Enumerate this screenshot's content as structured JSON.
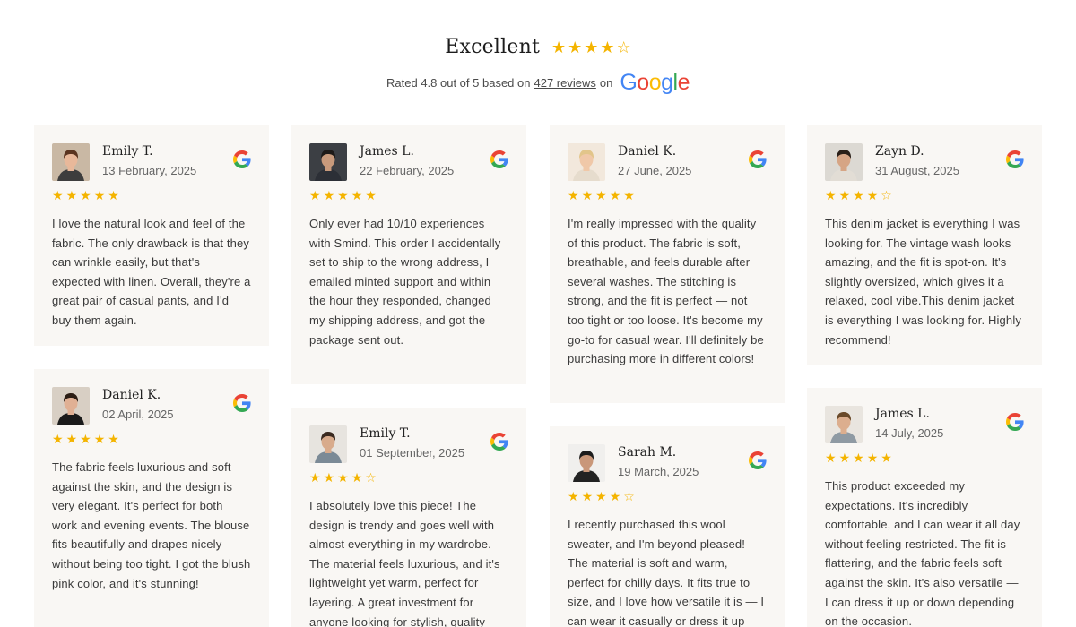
{
  "header": {
    "title": "Excellent",
    "rating_stars": 4,
    "rating_text_pre": "Rated 4.8 out of 5 based on",
    "reviews_link": "427 reviews",
    "rating_text_post": "on",
    "brand": "Google"
  },
  "colors": {
    "star": "#f4b400",
    "card_bg": "#f9f7f4",
    "google_blue": "#4285F4",
    "google_red": "#EA4335",
    "google_yellow": "#FBBC05",
    "google_green": "#34A853"
  },
  "reviews": [
    {
      "name": "Emily T.",
      "date": "13 February, 2025",
      "stars": 5,
      "text": "I love the natural look and feel of the fabric. The only drawback is that they can wrinkle easily, but that's expected with linen. Overall, they're a great pair of casual pants, and I'd buy them again."
    },
    {
      "name": "Daniel K.",
      "date": "02 April, 2025",
      "stars": 5,
      "text": "The fabric feels luxurious and soft against the skin, and the design is very elegant. It's perfect for both work and evening events. The blouse fits beautifully and drapes nicely without being too tight. I got the blush pink color, and it's stunning!"
    },
    {
      "name": "James L.",
      "date": "22 February, 2025",
      "stars": 5,
      "text": "Only ever had 10/10 experiences with Smind. This order I accidentally set to ship to the wrong address, I emailed minted support and within the hour they responded, changed my shipping address, and got the package sent out."
    },
    {
      "name": "Emily T.",
      "date": "01 September, 2025",
      "stars": 4,
      "text": "I absolutely love this piece! The design is trendy and goes well with almost everything in my wardrobe. The material feels luxurious, and it's lightweight yet warm, perfect for layering. A great investment for anyone looking for stylish, quality"
    },
    {
      "name": "Daniel K.",
      "date": "27 June, 2025",
      "stars": 5,
      "text": "I'm really impressed with the quality of this product. The fabric is soft, breathable, and feels durable after several washes. The stitching is strong, and the fit is perfect — not too tight or too loose. It's become my go-to for casual wear. I'll definitely be purchasing more in different colors!"
    },
    {
      "name": "Sarah M.",
      "date": "19 March, 2025",
      "stars": 4,
      "text": "I recently purchased this wool sweater, and I'm beyond pleased! The material is soft and warm, perfect for chilly days. It fits true to size, and I love how versatile it is — I can wear it casually or dress it up"
    },
    {
      "name": "Zayn D.",
      "date": "31 August, 2025",
      "stars": 4,
      "text": "This denim jacket is everything I was looking for. The vintage wash looks amazing, and the fit is spot-on. It's slightly oversized, which gives it a relaxed, cool vibe.This denim jacket is everything I was looking for. Highly recommend!"
    },
    {
      "name": "James L.",
      "date": "14 July, 2025",
      "stars": 5,
      "text": "This product exceeded my expectations. It's incredibly comfortable, and I can wear it all day without feeling restricted. The fit is flattering, and the fabric feels soft against the skin. It's also versatile — I can dress it up or down depending on the occasion."
    }
  ]
}
